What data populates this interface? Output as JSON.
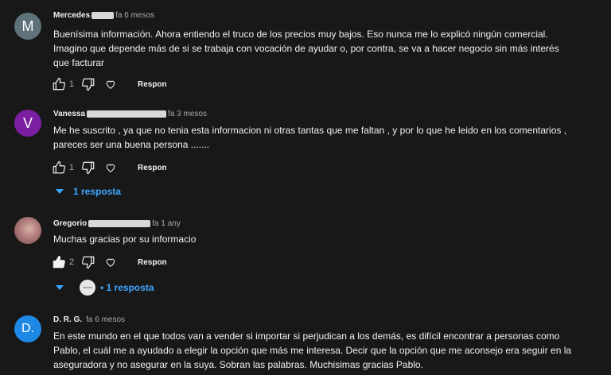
{
  "comments": [
    {
      "author": "Mercedes",
      "initial": "M",
      "avatar_color": "#5f7179",
      "time": "fa 6 mesos",
      "text_lines": [
        "Buenísima información. Ahora entiendo el truco de los precios muy bajos. Eso  nunca me lo explicó ningún comercial.",
        "Imagino que depende más de si se trabaja con vocación de ayudar o, por contra, se va a hacer negocio sin más interés",
        "que facturar"
      ],
      "likes": "1",
      "reply_label": "Respon"
    },
    {
      "author": "Vanessa",
      "initial": "V",
      "avatar_color": "#7b1fa2",
      "time": "fa 3 mesos",
      "text_lines": [
        "Me he suscrito , ya que no tenia esta informacion ni otras tantas que me faltan , y por lo que he leido en los comentarios ,",
        "pareces ser una buena persona ......."
      ],
      "likes": "1",
      "reply_label": "Respon",
      "replies_label": "1 resposta"
    },
    {
      "author": "Gregorio",
      "initial": "",
      "avatar_color": "#b07a7a",
      "time": "fa 1 any",
      "text_lines": [
        "Muchas gracias por su informacio"
      ],
      "likes": "2",
      "reply_label": "Respon",
      "replies_label": "• 1 resposta"
    },
    {
      "author": "D. R. G.",
      "initial": "D.",
      "avatar_color": "#1e88e5",
      "time": "fa 6 mesos",
      "text_lines": [
        "En este mundo en el que todos van a vender si importar si perjudican a los demás, es difícil encontrar a personas como",
        "Pablo, el cuál me a ayudado a elegir la opción que más me interesa. Decir que la opción que me aconsejo era seguir en la",
        "aseguradora y no asegurar en la suya. Sobran las palabras. Muchisimas gracias Pablo."
      ]
    }
  ],
  "colors": {
    "background": "#181818",
    "link": "#3ea6ff",
    "muted": "#aaaaaa"
  }
}
